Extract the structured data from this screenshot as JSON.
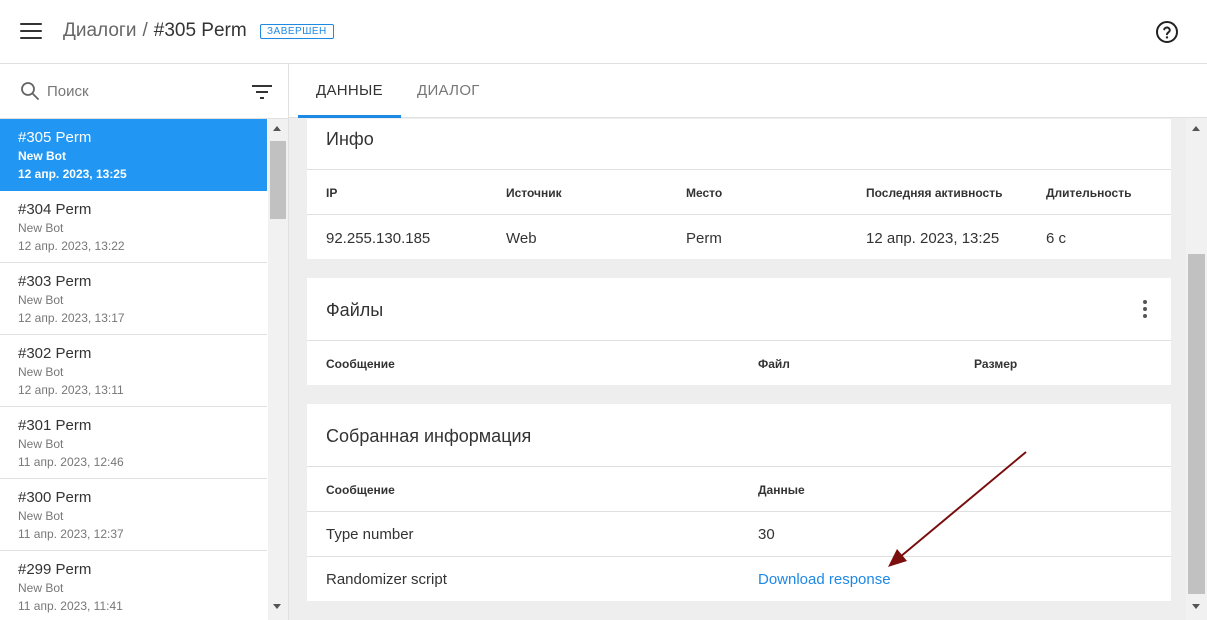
{
  "header": {
    "breadcrumb_root": "Диалоги",
    "breadcrumb_sep": "/",
    "breadcrumb_current": "#305 Perm",
    "status": "ЗАВЕРШЕН",
    "menu_icon": "menu-icon",
    "help_icon": "help-circle-icon"
  },
  "sidebar": {
    "search_placeholder": "Поиск",
    "search_value": "",
    "dialogs": [
      {
        "title": "#305 Perm",
        "bot": "New Bot",
        "date": "12 апр. 2023, 13:25",
        "active": true
      },
      {
        "title": "#304 Perm",
        "bot": "New Bot",
        "date": "12 апр. 2023, 13:22"
      },
      {
        "title": "#303 Perm",
        "bot": "New Bot",
        "date": "12 апр. 2023, 13:17"
      },
      {
        "title": "#302 Perm",
        "bot": "New Bot",
        "date": "12 апр. 2023, 13:11"
      },
      {
        "title": "#301 Perm",
        "bot": "New Bot",
        "date": "11 апр. 2023, 12:46"
      },
      {
        "title": "#300 Perm",
        "bot": "New Bot",
        "date": "11 апр. 2023, 12:37"
      },
      {
        "title": "#299 Perm",
        "bot": "New Bot",
        "date": "11 апр. 2023, 11:41"
      }
    ]
  },
  "tabs": [
    {
      "label": "ДАННЫЕ",
      "active": true
    },
    {
      "label": "ДИАЛОГ",
      "active": false
    }
  ],
  "info": {
    "title": "Инфо",
    "columns": [
      "IP",
      "Источник",
      "Место",
      "Последняя активность",
      "Длительность"
    ],
    "row": [
      "92.255.130.185",
      "Web",
      "Perm",
      "12 апр. 2023, 13:25",
      "6 с"
    ]
  },
  "files": {
    "title": "Файлы",
    "columns": [
      "Сообщение",
      "Файл",
      "Размер"
    ]
  },
  "collected": {
    "title": "Собранная информация",
    "columns": [
      "Сообщение",
      "Данные"
    ],
    "rows": [
      {
        "message": "Type number",
        "data": "30"
      },
      {
        "message": "Randomizer script",
        "data": "Download response",
        "is_link": true
      }
    ]
  },
  "colors": {
    "accent": "#1e88e5",
    "active_item": "#2196f3",
    "background": "#eeeeee",
    "annotation_arrow": "#7b0f0f"
  }
}
